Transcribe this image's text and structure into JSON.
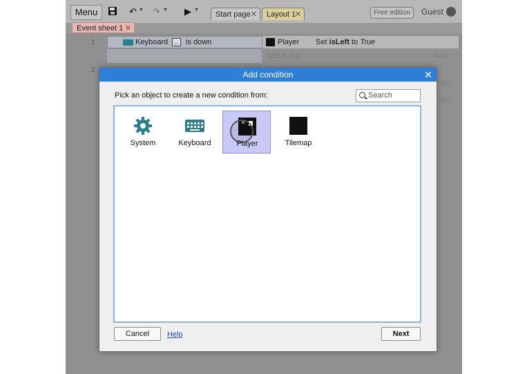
{
  "toolbar": {
    "menu_label": "Menu",
    "free_edition": "Free edition",
    "guest_label": "Guest"
  },
  "tabs": [
    {
      "label": "Start page"
    },
    {
      "label": "Layout 1"
    }
  ],
  "sheet_tab": {
    "label": "Event sheet 1"
  },
  "events": {
    "row1_number": "1",
    "row2_number": "2",
    "condition_object": "Keyboard",
    "condition_text": "is down",
    "action_object": "Player",
    "action_prefix": "Set",
    "action_var": "isLeft",
    "action_to": "to",
    "action_value": "True",
    "add_action": "Add action",
    "add_right": "Add...",
    "add_right_partial": "dd..."
  },
  "dialog": {
    "title": "Add condition",
    "prompt": "Pick an object to create a new condition from:",
    "search_placeholder": "Search",
    "objects": [
      {
        "label": "System",
        "icon": "gear-icon",
        "color": "#2b7f8c"
      },
      {
        "label": "Keyboard",
        "icon": "keyboard-icon",
        "color": "#2b7f8c"
      },
      {
        "label": "Player",
        "icon": "sprite-icon",
        "selected": true
      },
      {
        "label": "Tilemap",
        "icon": "tilemap-icon"
      }
    ],
    "cancel_label": "Cancel",
    "help_label": "Help",
    "next_label": "Next"
  },
  "colors": {
    "accent": "#2f7ed8",
    "selection": "#c9c9f6",
    "teal_icon": "#2b7f8c"
  }
}
